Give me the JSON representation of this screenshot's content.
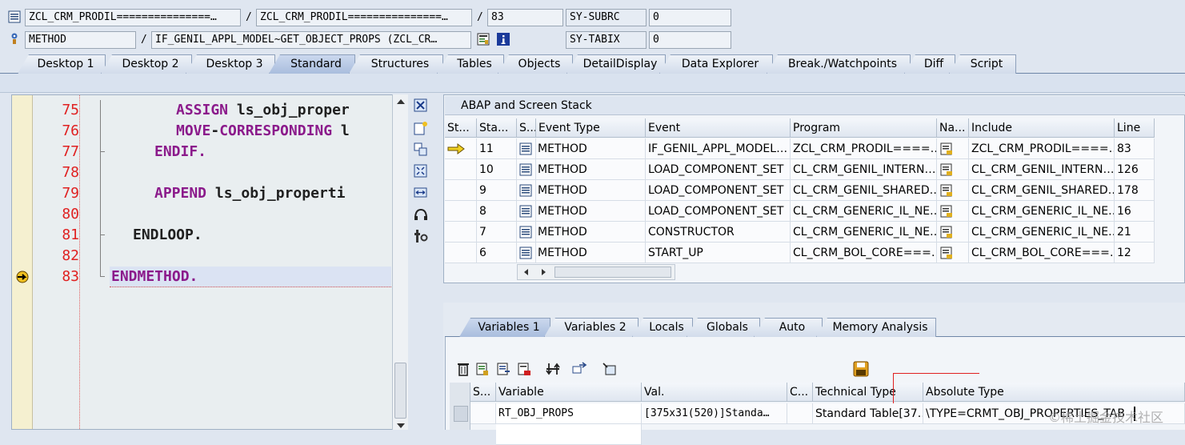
{
  "header": {
    "row1": {
      "program_field": "ZCL_CRM_PRODIL===============…",
      "include_field": "ZCL_CRM_PRODIL===============…",
      "line_field": "83",
      "sy_label": "SY-SUBRC",
      "sy_value": "0",
      "separator": "/"
    },
    "row2": {
      "event_type_field": "METHOD",
      "event_field": "IF_GENIL_APPL_MODEL~GET_OBJECT_PROPS (ZCL_CR…",
      "sy_label": "SY-TABIX",
      "sy_value": "0",
      "separator": "/"
    }
  },
  "main_tabs": [
    {
      "label": "Desktop 1"
    },
    {
      "label": "Desktop 2"
    },
    {
      "label": "Desktop 3"
    },
    {
      "label": "Standard"
    },
    {
      "label": "Structures"
    },
    {
      "label": "Tables"
    },
    {
      "label": "Objects"
    },
    {
      "label": "DetailDisplay"
    },
    {
      "label": "Data Explorer"
    },
    {
      "label": "Break./Watchpoints"
    },
    {
      "label": "Diff"
    },
    {
      "label": "Script"
    }
  ],
  "active_main_tab": "Standard",
  "editor": {
    "lines": [
      {
        "num": "75",
        "tokens": [
          {
            "t": "ASSIGN ",
            "k": "kw"
          },
          {
            "t": "ls_obj_proper",
            "k": "id"
          }
        ]
      },
      {
        "num": "76",
        "tokens": [
          {
            "t": "MOVE",
            "k": "kw"
          },
          {
            "t": "-",
            "k": "id"
          },
          {
            "t": "CORRESPONDING ",
            "k": "kw"
          },
          {
            "t": "l",
            "k": "id"
          }
        ]
      },
      {
        "num": "77",
        "tokens": [
          {
            "t": "ENDIF.",
            "k": "kw"
          }
        ]
      },
      {
        "num": "78",
        "tokens": []
      },
      {
        "num": "79",
        "tokens": [
          {
            "t": "APPEND ",
            "k": "kw"
          },
          {
            "t": "ls_obj_properti",
            "k": "id"
          }
        ]
      },
      {
        "num": "80",
        "tokens": []
      },
      {
        "num": "81",
        "tokens": [
          {
            "t": "ENDLOOP.",
            "k": "id"
          }
        ]
      },
      {
        "num": "82",
        "tokens": []
      },
      {
        "num": "83",
        "tokens": [
          {
            "t": "ENDMETHOD.",
            "k": "kw"
          }
        ]
      }
    ],
    "current_line": "83"
  },
  "stack": {
    "title": "ABAP and Screen Stack",
    "columns": [
      "St...",
      "Sta...",
      "S...",
      "Event Type",
      "Event",
      "Program",
      "Na...",
      "Include",
      "Line"
    ],
    "rows": [
      {
        "level": "11",
        "event_type": "METHOD",
        "event": "IF_GENIL_APPL_MODEL…",
        "program": "ZCL_CRM_PRODIL====…",
        "include": "ZCL_CRM_PRODIL====…",
        "line": "83",
        "current": true
      },
      {
        "level": "10",
        "event_type": "METHOD",
        "event": "LOAD_COMPONENT_SET",
        "program": "CL_CRM_GENIL_INTERN…",
        "include": "CL_CRM_GENIL_INTERN…",
        "line": "126",
        "current": false
      },
      {
        "level": "9",
        "event_type": "METHOD",
        "event": "LOAD_COMPONENT_SET",
        "program": "CL_CRM_GENIL_SHARED…",
        "include": "CL_CRM_GENIL_SHARED…",
        "line": "178",
        "current": false
      },
      {
        "level": "8",
        "event_type": "METHOD",
        "event": "LOAD_COMPONENT_SET",
        "program": "CL_CRM_GENERIC_IL_NE…",
        "include": "CL_CRM_GENERIC_IL_NE…",
        "line": "16",
        "current": false
      },
      {
        "level": "7",
        "event_type": "METHOD",
        "event": "CONSTRUCTOR",
        "program": "CL_CRM_GENERIC_IL_NE…",
        "include": "CL_CRM_GENERIC_IL_NE…",
        "line": "21",
        "current": false
      },
      {
        "level": "6",
        "event_type": "METHOD",
        "event": "START_UP",
        "program": "CL_CRM_BOL_CORE===…",
        "include": "CL_CRM_BOL_CORE===…",
        "line": "12",
        "current": false
      }
    ]
  },
  "var_tabs": [
    {
      "label": "Variables 1"
    },
    {
      "label": "Variables 2"
    },
    {
      "label": "Locals"
    },
    {
      "label": "Globals"
    },
    {
      "label": "Auto"
    },
    {
      "label": "Memory Analysis"
    }
  ],
  "active_var_tab": "Variables 1",
  "variables": {
    "columns": [
      "S...",
      "Variable",
      "Val.",
      "C...",
      "Technical Type",
      "Absolute Type"
    ],
    "rows": [
      {
        "variable": "RT_OBJ_PROPS",
        "value": "[375x31(520)]Standa…",
        "technical_type": "Standard Table[37…",
        "absolute_type": "\\TYPE=CRMT_OBJ_PROPERTIES_TAB"
      }
    ]
  },
  "watermark": "©稀土掘金技术社区",
  "colors": {
    "keyword": "#8b1a8b",
    "line_number": "#e02020",
    "annotation": "#e02020"
  }
}
